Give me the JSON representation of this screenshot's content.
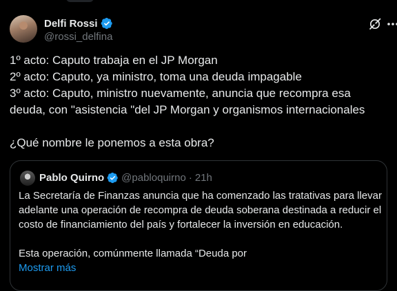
{
  "author": {
    "name": "Delfi Rossi",
    "handle": "@rossi_delfina"
  },
  "tweet": {
    "lines": [
      "1º acto: Caputo trabaja en el JP Morgan",
      "2º acto: Caputo, ya ministro, toma una deuda impagable",
      "3º acto: Caputo, ministro nuevamente, anuncia que recompra esa",
      "deuda, con \"asistencia \"del JP Morgan y organismos internacionales",
      "¿Qué nombre le ponemos a esta obra?"
    ]
  },
  "quote": {
    "name": "Pablo Quirno",
    "handle": "@pabloquirno",
    "separator": "·",
    "time": "21h",
    "lines": [
      "La Secretaría de Finanzas anuncia que ha comenzado las tratativas para  llevar",
      "adelante una operación de recompra de deuda soberana destinada a reducir el",
      "costo de financiamiento del país y fortalecer la inversión en educación.",
      "Esta operación, comúnmente llamada “Deuda por"
    ],
    "show_more": "Mostrar más"
  },
  "colors": {
    "background": "#000000",
    "text": "#e7e9ea",
    "secondary": "#71767b",
    "accent": "#1d9bf0",
    "border": "#2f3336"
  },
  "icons": [
    "verified-badge-icon",
    "grok-icon",
    "more-options-icon"
  ]
}
